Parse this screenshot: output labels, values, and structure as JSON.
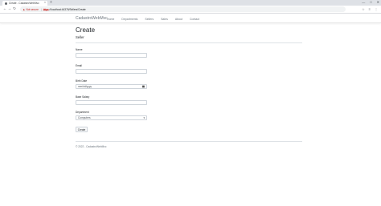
{
  "browser": {
    "tab_title": "Create - CadastroWebMvc",
    "tab_close": "×",
    "new_tab": "+",
    "window_controls": [
      "—",
      "□",
      "✕"
    ],
    "nav": {
      "back": "←",
      "forward": "→",
      "reload": "↻"
    },
    "security_label": "Not secure",
    "url_scheme": "https",
    "url_rest": "://localhost:44376/Sellers/Create",
    "toolbar_icons": [
      "☆",
      "≡",
      "⋮"
    ]
  },
  "navbar": {
    "brand": "CadastroWebMvc",
    "links": [
      "Home",
      "Departments",
      "Sellers",
      "Sales",
      "About",
      "Contact"
    ]
  },
  "page": {
    "title": "Create",
    "subtitle": "Seller"
  },
  "form": {
    "name_label": "Name",
    "name_value": "",
    "email_label": "Email",
    "email_value": "",
    "birth_label": "Birth Date",
    "birth_placeholder": "mm/dd/yyyy",
    "salary_label": "Base Salary",
    "salary_value": "",
    "department_label": "Department",
    "department_selected": "Computers",
    "submit_label": "Create"
  },
  "footer": {
    "text": "© 2022 - CadastroWebMvc"
  }
}
